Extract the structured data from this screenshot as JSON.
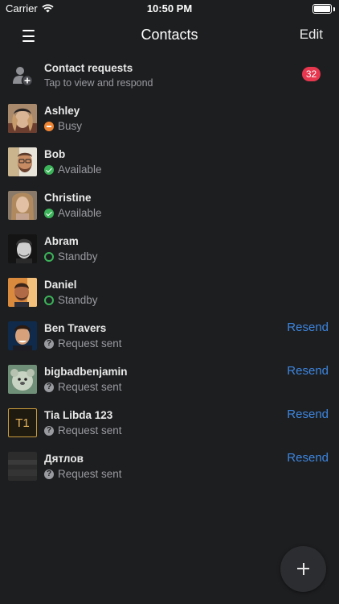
{
  "status_bar": {
    "carrier": "Carrier",
    "time": "10:50 PM"
  },
  "nav": {
    "title": "Contacts",
    "edit_label": "Edit"
  },
  "requests": {
    "title": "Contact requests",
    "subtitle": "Tap to view and respond",
    "badge": "32"
  },
  "contacts": [
    {
      "name": "Ashley",
      "status": "Busy",
      "status_type": "busy"
    },
    {
      "name": "Bob",
      "status": "Available",
      "status_type": "available"
    },
    {
      "name": "Christine",
      "status": "Available",
      "status_type": "available"
    },
    {
      "name": "Abram",
      "status": "Standby",
      "status_type": "standby"
    },
    {
      "name": "Daniel",
      "status": "Standby",
      "status_type": "standby"
    },
    {
      "name": "Ben Travers",
      "status": "Request sent",
      "status_type": "pending",
      "action": "Resend"
    },
    {
      "name": "bigbadbenjamin",
      "status": "Request sent",
      "status_type": "pending",
      "action": "Resend"
    },
    {
      "name": "Tia Libda 123",
      "status": "Request sent",
      "status_type": "pending",
      "action": "Resend",
      "avatar_text": "T1"
    },
    {
      "name": "Дятлов",
      "status": "Request sent",
      "status_type": "pending",
      "action": "Resend"
    }
  ],
  "pending_icon_glyph": "?",
  "colors": {
    "background": "#1d1e20",
    "accent_link": "#3d86e0",
    "badge": "#e7374f",
    "busy": "#ef8532",
    "available": "#3cb45a",
    "secondary_text": "#9a9ba0"
  },
  "icons": {
    "menu": "hamburger-icon",
    "requests": "add-user-icon",
    "fab": "plus-icon"
  }
}
